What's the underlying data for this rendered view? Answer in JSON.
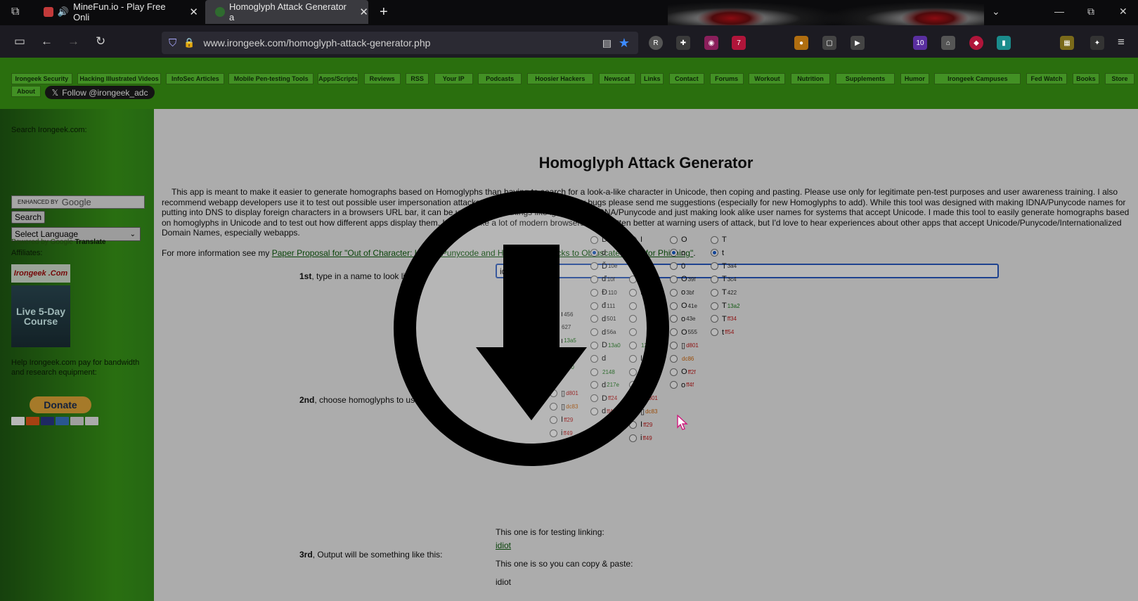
{
  "browser": {
    "tabs": [
      {
        "title": "MineFun.io - Play Free Onli",
        "audio_icon": "speaker-icon",
        "favicon_color": "#c23a3a"
      },
      {
        "title": "Homoglyph Attack Generator a",
        "favicon_color": "#2f6b2f",
        "active": true
      }
    ],
    "new_tab": "+",
    "url": "www.irongeek.com/homoglyph-attack-generator.php",
    "extension_badges": [
      "7",
      "10"
    ]
  },
  "site_menu": {
    "items": [
      "Irongeek Security",
      "Hacking Illustrated Videos",
      "InfoSec Articles",
      "Mobile Pen-testing Tools",
      "Apps/Scripts",
      "Reviews",
      "RSS",
      "Your IP",
      "Podcasts",
      "Hoosier Hackers",
      "Newscat",
      "Links",
      "Contact",
      "Forums",
      "Workout",
      "Nutrition",
      "Supplements",
      "Humor",
      "Irongeek Campuses",
      "Fed Watch",
      "Books",
      "Store",
      "About"
    ],
    "follow_button": "Follow @irongeek_adc"
  },
  "sidebar": {
    "search_label": "Search Irongeek.com:",
    "search_enhanced": "ENHANCED BY",
    "search_brand": "Google",
    "search_button": "Search",
    "language_select": "Select Language",
    "translate_prefix": "Powered by",
    "translate_brand": "Google",
    "translate_label": "Translate",
    "affiliates_label": "Affiliates:",
    "affiliate_1": "Irongeek .Com",
    "affiliate_2": "Live 5-Day Course",
    "help_text": "Help Irongeek.com pay for bandwidth and research equipment:",
    "donate_button": "Donate"
  },
  "main": {
    "title": "Homoglyph Attack Generator",
    "intro": "This app is meant to make it easier to generate homographs based on Homoglyphs than having to search for a look-a-like character in Unicode, then coping and pasting. Please use only for legitimate pen-test purposes and user awareness training. I also recommend webapp developers use it to test out possible user impersonation attacks in their code. If you find any bugs please send me suggestions (especially for new Homoglyphs to add). While this tool was designed with making IDNA/Punycode names for putting into DNS to display foreign characters in a browsers URL bar, it can be used for other things like ignoring the IDNA/Punycode and just making look alike user names for systems that accept Unicode. I made this tool to easily generate homographs based on homoglyphs in Unicode and to test out how different apps display them. It seems like a lot of modern browsers have gotten better at warning users of attack, but I'd love to hear experiences about other apps that accept Unicode/Punycode/Internationalized Domain Names, especially webapps.",
    "more_info_prefix": "For more information see my",
    "more_info_link": "Paper Proposal for \"Out of Character: Use of Punycode and Homoglyph Attacks to Obfuscate URLs for Phishing\"",
    "more_info_suffix": ".",
    "step1_num": "1st",
    "step1_text": ", type in a name to look like:",
    "name_value": "idiot",
    "step2_num": "2nd",
    "step2_text": ", choose homoglyphs to use:",
    "step3_num": "3rd",
    "step3_text": ", Output will be something like this:",
    "link_test_label": "This one is for testing linking:",
    "link_test_value": "idiot",
    "copy_label": "This one is so you can copy & paste:",
    "copy_value": "idiot"
  },
  "glyph_columns": [
    {
      "name": "i-col",
      "rows": [
        {
          "g": "ı",
          "c": "456",
          "k": "dk"
        },
        {
          "g": "",
          "c": "627",
          "k": "dk"
        },
        {
          "g": "ı",
          "c": "13a5",
          "k": "green"
        },
        {
          "g": "I",
          "c": "16c1",
          "k": "green"
        },
        {
          "g": "",
          "c": "2160",
          "k": "green"
        },
        {
          "g": "",
          "c": "",
          "k": "dk"
        },
        {
          "g": "▯",
          "c": "d801",
          "k": "red"
        },
        {
          "g": "▯",
          "c": "dc83",
          "k": "orange"
        },
        {
          "g": "I",
          "c": "ff29",
          "k": "red"
        },
        {
          "g": "i",
          "c": "ff49",
          "k": "red"
        }
      ]
    },
    {
      "name": "d-col",
      "rows": [
        {
          "g": "D",
          "c": "",
          "k": "dk"
        },
        {
          "g": "d",
          "c": "",
          "k": "dk",
          "on": true
        },
        {
          "g": "Ď",
          "c": "10e",
          "k": "dk"
        },
        {
          "g": "ď",
          "c": "10f",
          "k": "dk"
        },
        {
          "g": "Đ",
          "c": "110",
          "k": "dk"
        },
        {
          "g": "đ",
          "c": "111",
          "k": "dk"
        },
        {
          "g": "d",
          "c": "501",
          "k": "dk"
        },
        {
          "g": "d",
          "c": "56a",
          "k": "dk"
        },
        {
          "g": "D",
          "c": "13a0",
          "k": "green"
        },
        {
          "g": "d",
          "c": "",
          "k": "dk"
        },
        {
          "g": "",
          "c": "2148",
          "k": "green"
        },
        {
          "g": "d",
          "c": "217e",
          "k": "green"
        },
        {
          "g": "D",
          "c": "ff24",
          "k": "red"
        },
        {
          "g": "d",
          "c": "ff44",
          "k": "red"
        }
      ]
    },
    {
      "name": "i-col-2",
      "rows": [
        {
          "g": "I",
          "c": "",
          "k": "dk"
        },
        {
          "g": "i",
          "c": "",
          "k": "dk",
          "on": true
        },
        {
          "g": "l",
          "c": "",
          "k": "dk"
        },
        {
          "g": "ı",
          "c": "26",
          "k": "dk"
        },
        {
          "g": "ı",
          "c": "3",
          "k": "dk"
        },
        {
          "g": "",
          "c": "",
          "k": "dk"
        },
        {
          "g": "",
          "c": "",
          "k": "dk"
        },
        {
          "g": "",
          "c": "",
          "k": "dk"
        },
        {
          "g": "",
          "c": "13a5",
          "k": "green"
        },
        {
          "g": "I",
          "c": "16c1",
          "k": "green"
        },
        {
          "g": "I",
          "c": "2160",
          "k": "dk"
        },
        {
          "g": "i",
          "c": "2170",
          "k": "green"
        },
        {
          "g": "▯",
          "c": "d801",
          "k": "red"
        },
        {
          "g": "▯",
          "c": "dc83",
          "k": "orange"
        },
        {
          "g": "I",
          "c": "ff29",
          "k": "red"
        },
        {
          "g": "i",
          "c": "ff49",
          "k": "red"
        }
      ]
    },
    {
      "name": "o-col",
      "rows": [
        {
          "g": "O",
          "c": "",
          "k": "dk"
        },
        {
          "g": "o",
          "c": "",
          "k": "dk",
          "on": true
        },
        {
          "g": "0",
          "c": "",
          "k": "dk"
        },
        {
          "g": "O",
          "c": "39f",
          "k": "dk"
        },
        {
          "g": "o",
          "c": "3bf",
          "k": "dk"
        },
        {
          "g": "O",
          "c": "41e",
          "k": "dk"
        },
        {
          "g": "o",
          "c": "43e",
          "k": "dk"
        },
        {
          "g": "O",
          "c": "555",
          "k": "dk"
        },
        {
          "g": "▯",
          "c": "d801",
          "k": "red"
        },
        {
          "g": "",
          "c": "dc86",
          "k": "orange"
        },
        {
          "g": "O",
          "c": "ff2f",
          "k": "red"
        },
        {
          "g": "o",
          "c": "ff4f",
          "k": "red"
        }
      ]
    },
    {
      "name": "t-col",
      "rows": [
        {
          "g": "T",
          "c": "",
          "k": "dk"
        },
        {
          "g": "t",
          "c": "",
          "k": "dk",
          "on": true
        },
        {
          "g": "T",
          "c": "3a4",
          "k": "dk"
        },
        {
          "g": "T",
          "c": "3c4",
          "k": "dk"
        },
        {
          "g": "T",
          "c": "422",
          "k": "dk"
        },
        {
          "g": "T",
          "c": "13a2",
          "k": "green"
        },
        {
          "g": "T",
          "c": "ff34",
          "k": "red"
        },
        {
          "g": "t",
          "c": "ff54",
          "k": "red"
        }
      ]
    }
  ],
  "colors": {
    "site_green": "#3b9a14",
    "menu_green": "#5cc932",
    "link_green": "#0d5e0d",
    "content_bg": "#efefef",
    "input_focus": "#2a5cc7"
  },
  "overlay": {
    "icon": "download-arrow-circle-icon"
  }
}
